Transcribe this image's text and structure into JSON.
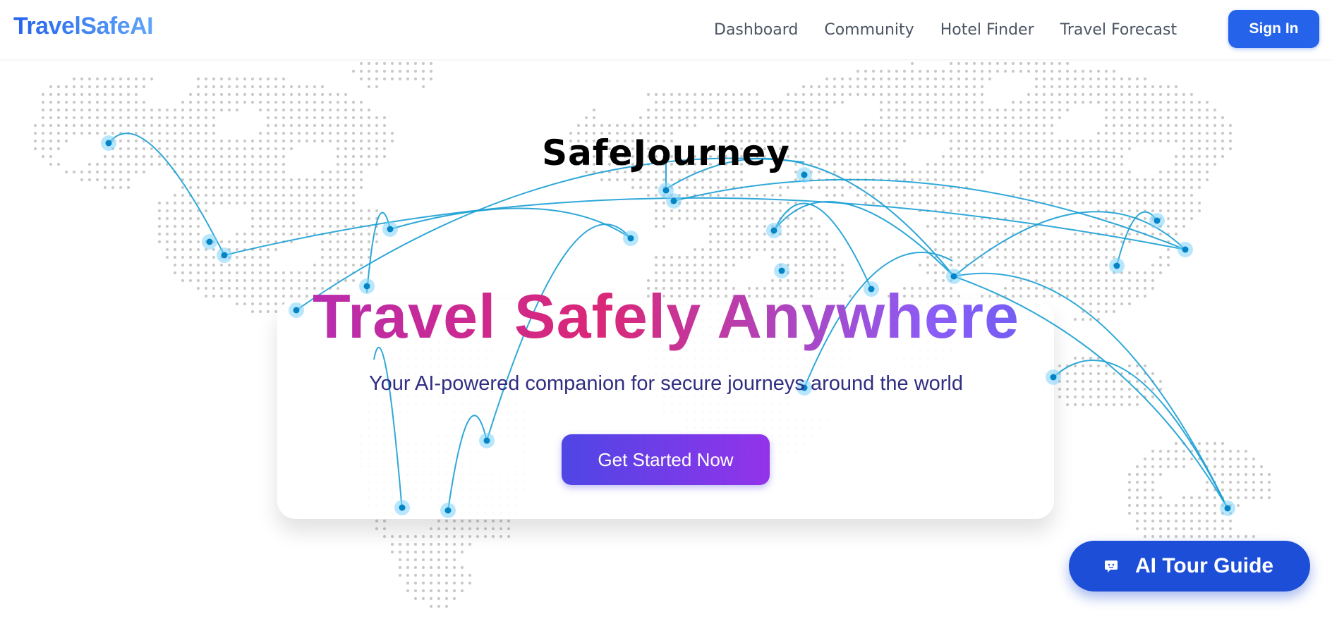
{
  "nav": {
    "brand": "TravelSafeAI",
    "links": [
      "Dashboard",
      "Community",
      "Hotel Finder",
      "Travel Forecast"
    ],
    "signin": "Sign In"
  },
  "hero": {
    "logo": "SafeJourney",
    "title": "Travel Safely Anywhere",
    "subtitle": "Your AI-powered companion for secure journeys around the world",
    "cta": "Get Started Now"
  },
  "assistant": {
    "label": "AI Tour Guide",
    "icon": "chat-icon"
  },
  "colors": {
    "brand": "#2563eb",
    "route": "#1a9fd4",
    "cta_start": "#4f46e5",
    "cta_end": "#9333ea",
    "tour_button": "#1d4ed8"
  }
}
